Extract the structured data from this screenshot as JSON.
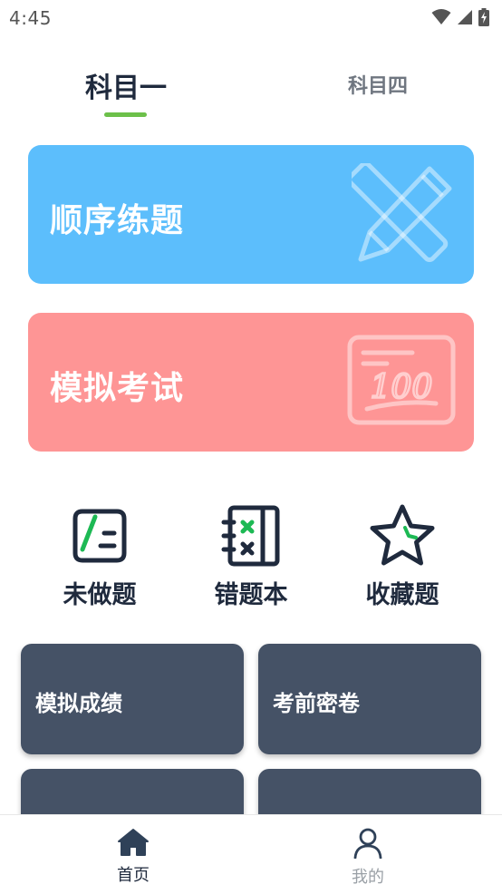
{
  "status_bar": {
    "time": "4:45"
  },
  "tabs": [
    {
      "label": "科目一",
      "active": true
    },
    {
      "label": "科目四",
      "active": false
    }
  ],
  "cards": {
    "sequential": {
      "label": "顺序练题",
      "color": "#5cbefc"
    },
    "mock_exam": {
      "label": "模拟考试",
      "color": "#fe9595",
      "icon_text": "100"
    }
  },
  "quick_actions": [
    {
      "label": "未做题",
      "icon": "undone-icon"
    },
    {
      "label": "错题本",
      "icon": "wrong-book-icon"
    },
    {
      "label": "收藏题",
      "icon": "star-icon"
    }
  ],
  "tiles": [
    {
      "label": "模拟成绩"
    },
    {
      "label": "考前密卷"
    },
    {
      "label": ""
    },
    {
      "label": ""
    }
  ],
  "bottom_nav": [
    {
      "label": "首页",
      "icon": "home-icon",
      "active": true
    },
    {
      "label": "我的",
      "icon": "user-icon",
      "active": false
    }
  ],
  "colors": {
    "accent": "#6cc04a",
    "text_dark": "#1f2a3d",
    "tile_bg": "#455266",
    "check_green": "#1db954"
  }
}
